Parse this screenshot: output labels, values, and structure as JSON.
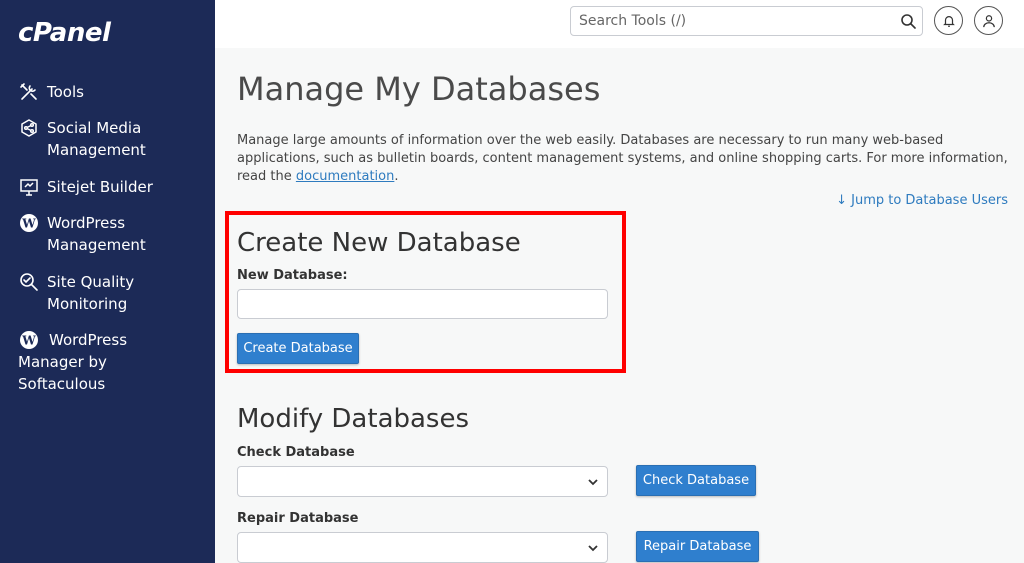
{
  "sidebar": {
    "logo": "cPanel",
    "items": [
      {
        "label": "Tools",
        "icon": "tools-icon"
      },
      {
        "label": "Social Media Management",
        "icon": "social-media-icon"
      },
      {
        "label": "Sitejet Builder",
        "icon": "monitor-icon"
      },
      {
        "label": "WordPress Management",
        "icon": "wordpress-icon"
      },
      {
        "label": "Site Quality Monitoring",
        "icon": "magnifier-check-icon"
      },
      {
        "label": "WordPress Manager by Softaculous",
        "icon": "wordpress-icon"
      }
    ],
    "background": "#1c2a57"
  },
  "header": {
    "search_placeholder": "Search Tools (/)",
    "icons": [
      "search-icon",
      "bell-icon",
      "user-icon"
    ]
  },
  "main": {
    "title": "Manage My Databases",
    "description": "Manage large amounts of information over the web easily. Databases are necessary to run many web-based applications, such as bulletin boards, content management systems, and online shopping carts. For more information, read the",
    "description_link": "documentation",
    "description_end": ".",
    "jump_link": "↓ Jump to Database Users",
    "create": {
      "heading": "Create New Database",
      "field_label": "New Database:",
      "field_value": "",
      "button_label": "Create Database"
    },
    "modify": {
      "heading": "Modify Databases",
      "check_label": "Check Database",
      "check_selected": "",
      "check_button": "Check Database",
      "repair_label": "Repair Database",
      "repair_selected": "",
      "repair_button": "Repair Database"
    }
  },
  "colors": {
    "accent": "#2f7fce",
    "link": "#2e7bbf",
    "highlight": "#ff0000"
  }
}
